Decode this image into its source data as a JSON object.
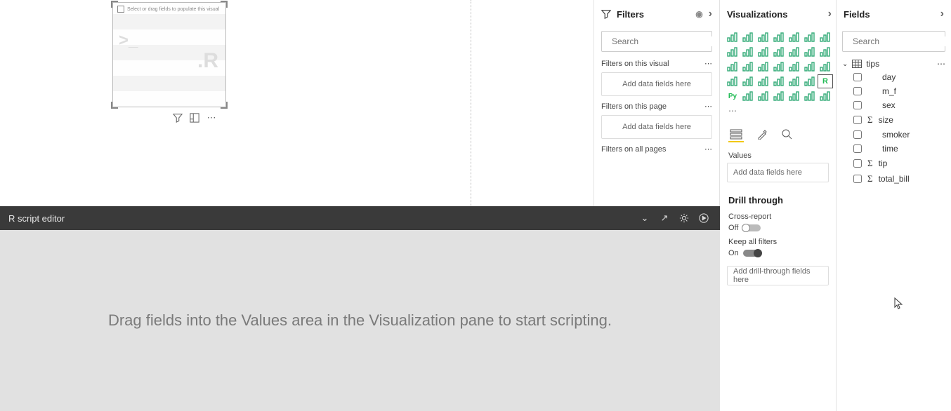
{
  "canvas": {
    "placeholder_hint": "Select or drag fields to populate this visual",
    "r_letter": ".R",
    "prompt": ">_"
  },
  "filters": {
    "title": "Filters",
    "search_placeholder": "Search",
    "sections": {
      "visual": {
        "label": "Filters on this visual",
        "drop": "Add data fields here"
      },
      "page": {
        "label": "Filters on this page",
        "drop": "Add data fields here"
      },
      "all": {
        "label": "Filters on all pages"
      }
    }
  },
  "viz": {
    "title": "Visualizations",
    "values_label": "Values",
    "values_drop": "Add data fields here",
    "drill_title": "Drill through",
    "cross_label": "Cross-report",
    "cross_state": "Off",
    "keep_label": "Keep all filters",
    "keep_state": "On",
    "drill_drop": "Add drill-through fields here",
    "icons": [
      "stacked-bar",
      "stacked-column",
      "clustered-bar",
      "clustered-column",
      "stacked-bar-100",
      "stacked-column-100",
      "line",
      "area",
      "stacked-area",
      "line-stacked-column",
      "line-clustered-column",
      "ribbon",
      "waterfall",
      "scatter",
      "pie",
      "donut",
      "treemap",
      "map",
      "filled-map",
      "funnel",
      "gauge",
      "card",
      "multi-row-card",
      "kpi",
      "slicer",
      "table",
      "matrix",
      "r-visual",
      "python-visual",
      "key-influencers",
      "decomposition-tree",
      "qna",
      "paginated",
      "power-apps",
      "power-automate",
      "more"
    ],
    "selected_icon": "r-visual"
  },
  "fields": {
    "title": "Fields",
    "search_placeholder": "Search",
    "table": "tips",
    "columns": [
      {
        "name": "day",
        "agg": false
      },
      {
        "name": "m_f",
        "agg": false
      },
      {
        "name": "sex",
        "agg": false
      },
      {
        "name": "size",
        "agg": true
      },
      {
        "name": "smoker",
        "agg": false
      },
      {
        "name": "time",
        "agg": false
      },
      {
        "name": "tip",
        "agg": true
      },
      {
        "name": "total_bill",
        "agg": true
      }
    ]
  },
  "r_editor": {
    "title": "R script editor",
    "message": "Drag fields into the Values area in the Visualization pane to start scripting."
  }
}
